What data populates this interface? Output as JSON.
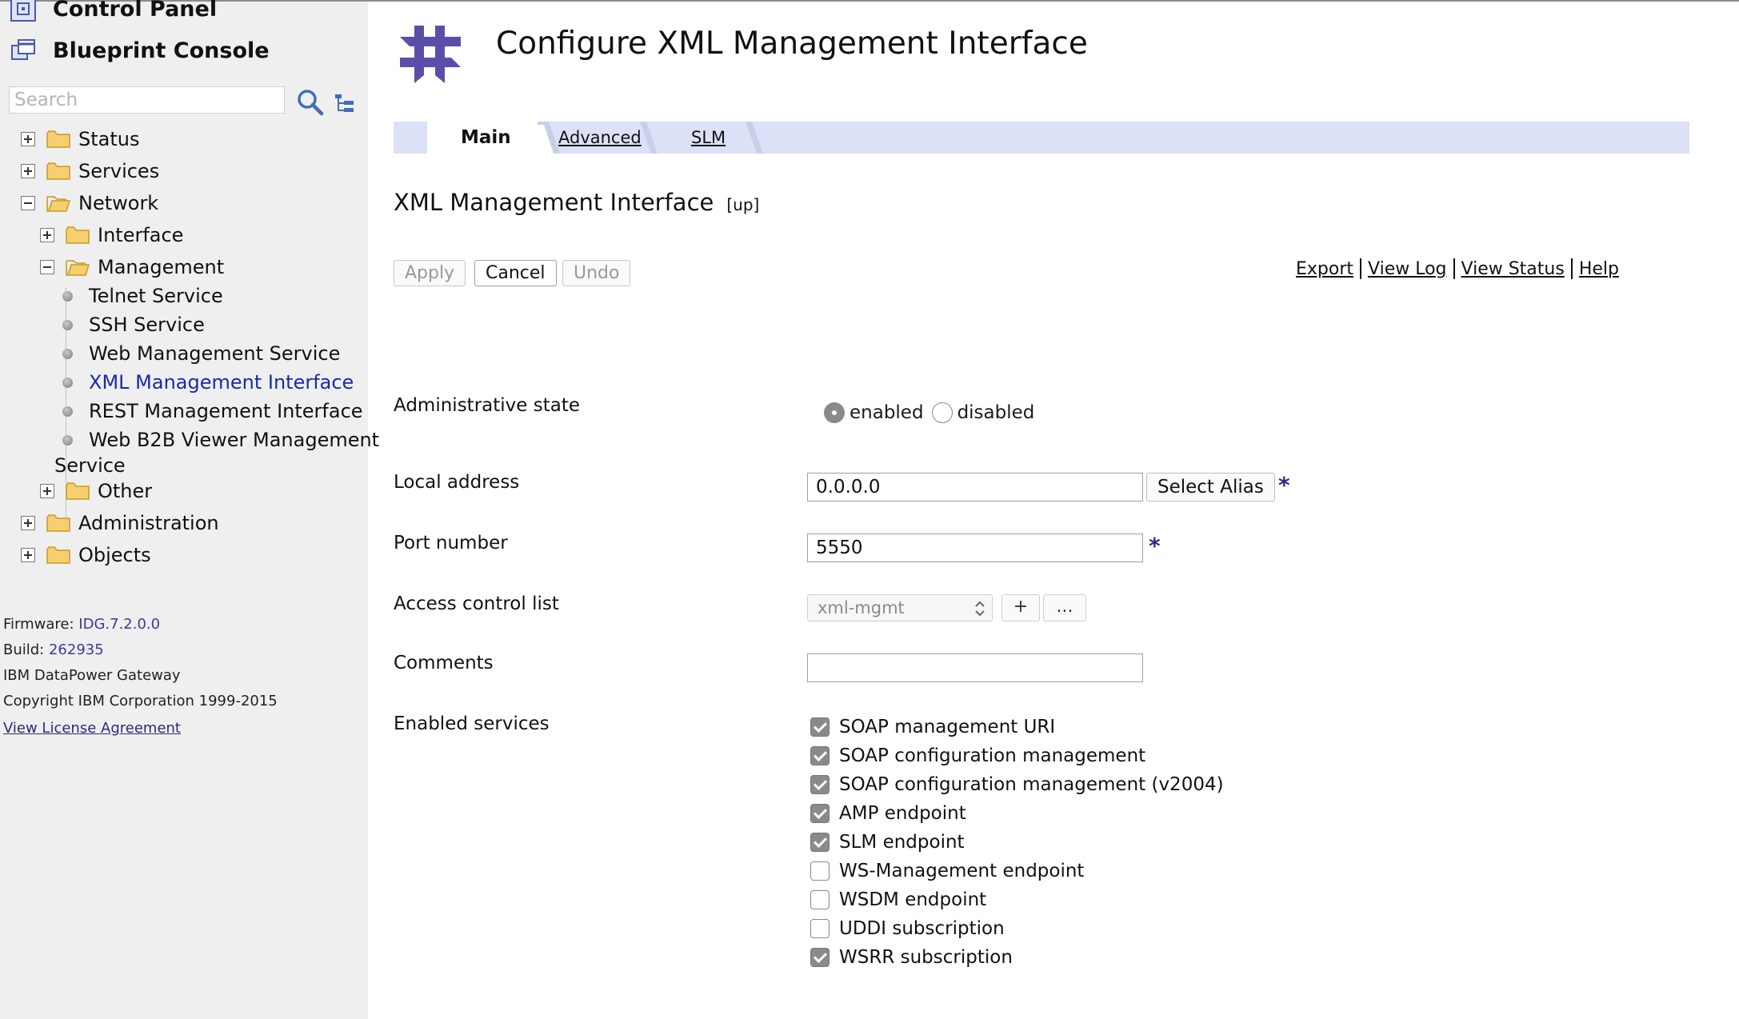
{
  "sidebar": {
    "control_panel": "Control Panel",
    "blueprint_console": "Blueprint Console",
    "search_placeholder": "Search",
    "tree": {
      "status": "Status",
      "services": "Services",
      "network": "Network",
      "interface": "Interface",
      "management": "Management",
      "telnet": "Telnet Service",
      "ssh": "SSH Service",
      "web_mgmt": "Web Management Service",
      "xml_mgmt": "XML Management Interface",
      "rest_mgmt": "REST Management Interface",
      "b2b_line1": "Web B2B Viewer Management",
      "b2b_line2": "Service",
      "other": "Other",
      "administration": "Administration",
      "objects": "Objects"
    },
    "footer": {
      "firmware_label": "Firmware:",
      "firmware_value": "IDG.7.2.0.0",
      "build_label": "Build:",
      "build_value": "262935",
      "product": "IBM DataPower Gateway",
      "copyright": "Copyright IBM Corporation 1999-2015",
      "license": "View License Agreement"
    }
  },
  "header": {
    "title": "Configure XML Management Interface"
  },
  "tabs": {
    "main": "Main",
    "advanced": "Advanced",
    "slm": "SLM"
  },
  "section": {
    "title": "XML Management Interface",
    "status": "[up]"
  },
  "buttons": {
    "apply": "Apply",
    "cancel": "Cancel",
    "undo": "Undo"
  },
  "actions": {
    "export": "Export",
    "view_log": "View Log",
    "view_status": "View Status",
    "help": "Help"
  },
  "form": {
    "admin_state": {
      "label": "Administrative state",
      "enabled": "enabled",
      "disabled": "disabled",
      "value": "enabled"
    },
    "local_address": {
      "label": "Local address",
      "value": "0.0.0.0",
      "select_alias": "Select Alias",
      "required": "*"
    },
    "port": {
      "label": "Port number",
      "value": "5550",
      "required": "*"
    },
    "acl": {
      "label": "Access control list",
      "value": "xml-mgmt",
      "add": "+",
      "edit": "..."
    },
    "comments": {
      "label": "Comments",
      "value": ""
    },
    "enabled_services": {
      "label": "Enabled services",
      "items": [
        {
          "label": "SOAP management URI",
          "checked": true
        },
        {
          "label": "SOAP configuration management",
          "checked": true
        },
        {
          "label": "SOAP configuration management (v2004)",
          "checked": true
        },
        {
          "label": "AMP endpoint",
          "checked": true
        },
        {
          "label": "SLM endpoint",
          "checked": true
        },
        {
          "label": "WS-Management endpoint",
          "checked": false
        },
        {
          "label": "WSDM endpoint",
          "checked": false
        },
        {
          "label": "UDDI subscription",
          "checked": false
        },
        {
          "label": "WSRR subscription",
          "checked": true
        }
      ]
    }
  },
  "colors": {
    "tab_bar": "#dce1f7",
    "sidebar_bg": "#efefef",
    "selected_link": "#1a2aa8",
    "logo": "#5a4fa8"
  }
}
